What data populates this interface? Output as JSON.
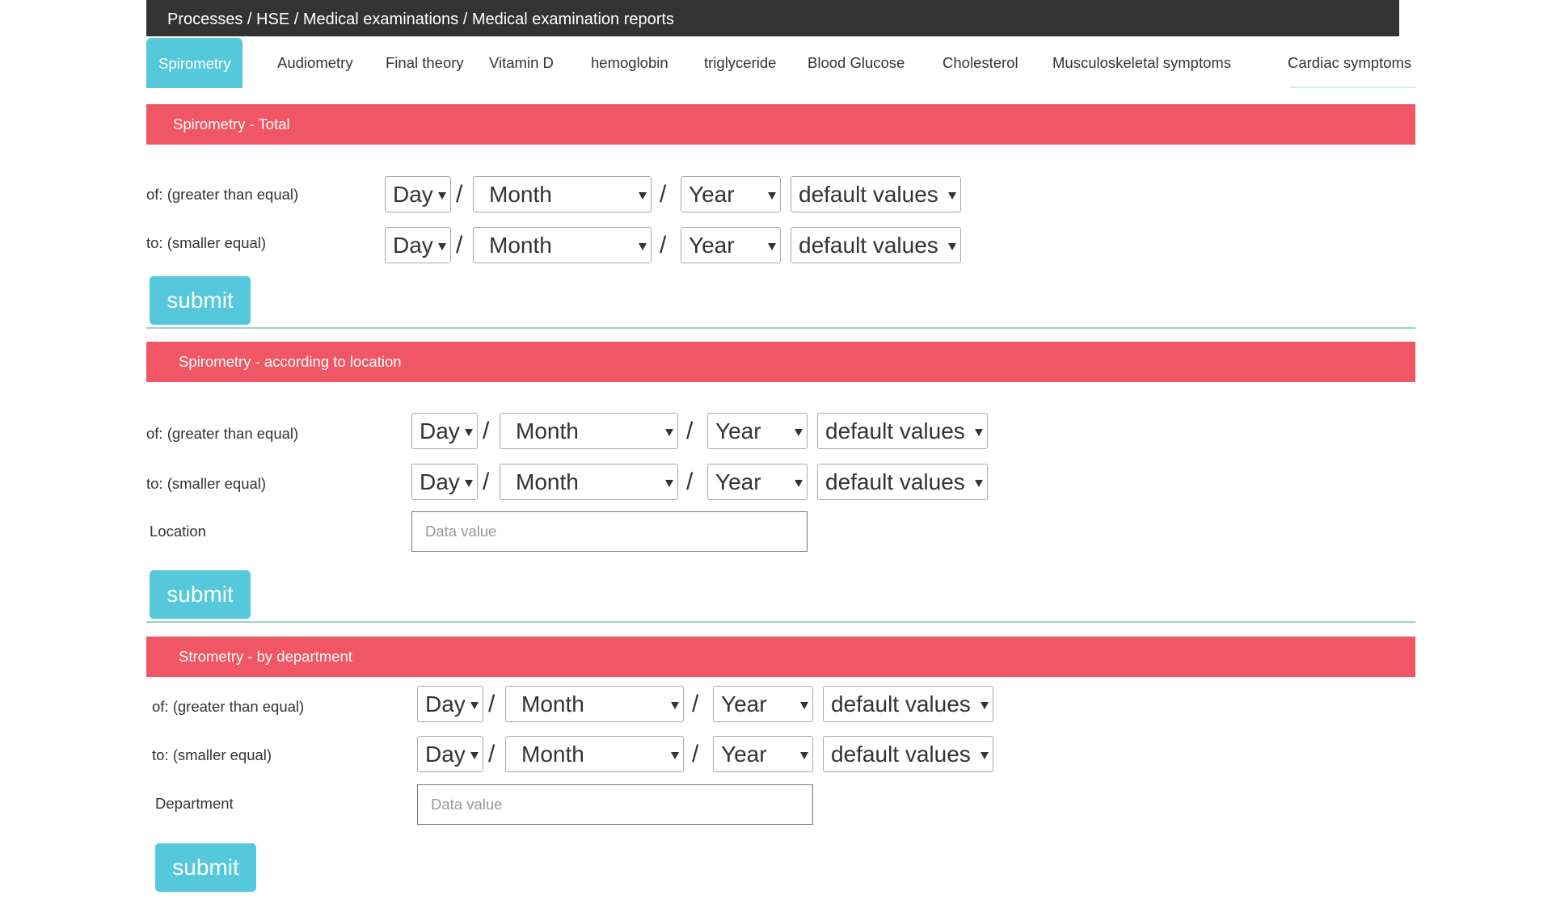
{
  "breadcrumb": "Processes / HSE / Medical examinations / Medical examination reports",
  "tabs": [
    {
      "label": "Spirometry",
      "active": true
    },
    {
      "label": "Audiometry"
    },
    {
      "label": "Final theory"
    },
    {
      "label": "Vitamin D"
    },
    {
      "label": "hemoglobin"
    },
    {
      "label": "triglyceride"
    },
    {
      "label": "Blood Glucose"
    },
    {
      "label": "Cholesterol"
    },
    {
      "label": "Musculoskeletal symptoms"
    },
    {
      "label": "Cardiac symptoms"
    }
  ],
  "sections": [
    {
      "title": "Spirometry - Total",
      "from_label": "of: (greater than equal)",
      "to_label": "to: (smaller equal)",
      "submit": "submit"
    },
    {
      "title": "Spirometry - according to location",
      "from_label": "of: (greater than equal)",
      "to_label": "to: (smaller equal)",
      "extra_label": "Location",
      "extra_placeholder": "Data value",
      "submit": "submit"
    },
    {
      "title": "Strometry - by department",
      "from_label": "of: (greater than equal)",
      "to_label": "to: (smaller equal)",
      "extra_label": "Department",
      "extra_placeholder": "Data value",
      "submit": "submit"
    }
  ],
  "date_fields": {
    "day": "Day",
    "month": "Month",
    "year": "Year",
    "preset": "default values",
    "separator": "/"
  },
  "colors": {
    "header_bar": "#333333",
    "accent": "#55c8dc",
    "section_header": "#f15664"
  }
}
